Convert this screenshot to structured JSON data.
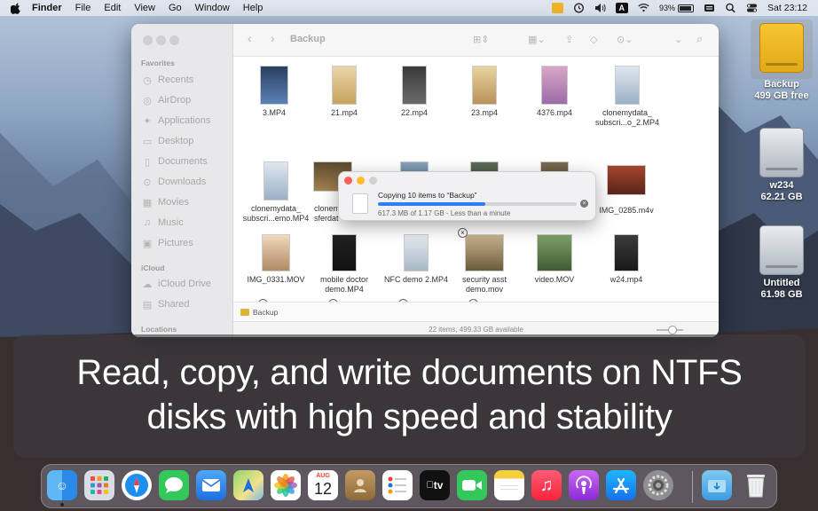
{
  "menubar": {
    "app_name": "Finder",
    "menus": [
      "File",
      "Edit",
      "View",
      "Go",
      "Window",
      "Help"
    ],
    "status": {
      "keyboard_input": "A",
      "battery": "93%",
      "clock": "Sat 23:12"
    }
  },
  "finder": {
    "title": "Backup",
    "sidebar": {
      "favorites_header": "Favorites",
      "favorites": [
        {
          "label": "Recents",
          "icon": "clock-icon"
        },
        {
          "label": "AirDrop",
          "icon": "airdrop-icon"
        },
        {
          "label": "Applications",
          "icon": "applications-icon"
        },
        {
          "label": "Desktop",
          "icon": "desktop-icon"
        },
        {
          "label": "Documents",
          "icon": "document-icon"
        },
        {
          "label": "Downloads",
          "icon": "download-icon"
        },
        {
          "label": "Movies",
          "icon": "film-icon"
        },
        {
          "label": "Music",
          "icon": "music-icon"
        },
        {
          "label": "Pictures",
          "icon": "photo-icon"
        }
      ],
      "icloud_header": "iCloud",
      "icloud": [
        {
          "label": "iCloud Drive",
          "icon": "cloud-icon"
        },
        {
          "label": "Shared",
          "icon": "shared-folder-icon"
        }
      ],
      "locations_header": "Locations"
    },
    "files": [
      {
        "name": "3.MP4"
      },
      {
        "name": "21.mp4"
      },
      {
        "name": "22.mp4"
      },
      {
        "name": "23.mp4"
      },
      {
        "name": "4376.mp4"
      },
      {
        "name": "clonemydata_\nsubscri...o_2.MP4"
      },
      {
        "name": "clonemydata_\nsubscri...emo.MP4"
      },
      {
        "name": "clonem\nsferdat"
      },
      {
        "name": ""
      },
      {
        "name": ""
      },
      {
        "name": ""
      },
      {
        "name": "IMG_0285.m4v"
      },
      {
        "name": "IMG_0331.MOV"
      },
      {
        "name": "mobile doctor\ndemo.MP4"
      },
      {
        "name": "NFC demo 2.MP4"
      },
      {
        "name": "security asst\ndemo.mov"
      },
      {
        "name": "video.MOV"
      },
      {
        "name": "w24.mp4"
      },
      {
        "name": ""
      },
      {
        "name": ""
      },
      {
        "name": ""
      },
      {
        "name": ""
      }
    ],
    "pathbar": "Backup",
    "status": "22 items, 499.33 GB available"
  },
  "copy_dialog": {
    "title": "Copying 10 items to “Backup”",
    "progress": 0.54,
    "detail": "617.3 MB of 1.17 GB - Less than a minute"
  },
  "desktop": {
    "drives": [
      {
        "name": "Backup",
        "size": "499 GB free"
      },
      {
        "name": "w234",
        "size": "62.21 GB"
      },
      {
        "name": "Untitled",
        "size": "61.98 GB"
      }
    ]
  },
  "banner": {
    "line1": "Read, copy, and write documents on NTFS",
    "line2": "disks with high speed and stability"
  },
  "dock": {
    "calendar_month": "AUG",
    "calendar_day": "12",
    "tv_label": "tv",
    "apps": [
      "Finder",
      "Launchpad",
      "Safari",
      "Messages",
      "Mail",
      "Maps",
      "Photos",
      "Calendar",
      "Contacts",
      "Reminders",
      "TV",
      "FaceTime",
      "Notes",
      "Music",
      "Podcasts",
      "App Store",
      "System Preferences",
      "Downloads",
      "Trash"
    ]
  }
}
